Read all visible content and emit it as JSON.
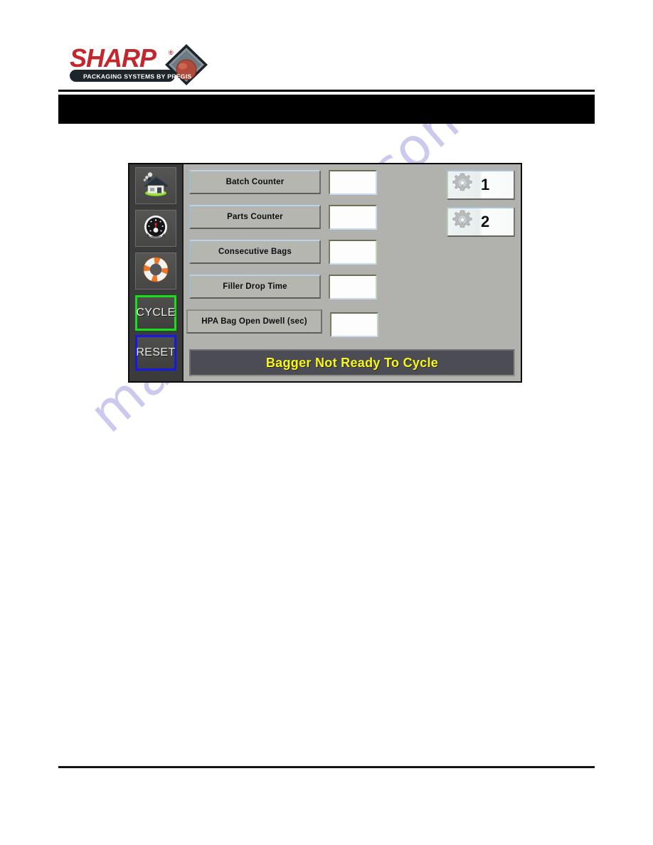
{
  "page": {
    "watermark": "manualshive.com",
    "background_color": "#ffffff"
  },
  "logo": {
    "brand": "SHARP",
    "registered_mark": "®",
    "tagline": "PACKAGING SYSTEMS BY PREGIS",
    "brand_color": "#c1272d",
    "tagline_bg": "#1d252c",
    "tagline_color": "#ffffff"
  },
  "header": {
    "black_bar_color": "#000000",
    "rule_color": "#000000"
  },
  "hmi": {
    "screen_bg": "#b1b1ad",
    "sidebar_bg": "#3b3b3b",
    "sidebar": {
      "items": [
        {
          "name": "home",
          "icon": "house-icon",
          "label": ""
        },
        {
          "name": "diagnostics",
          "icon": "gauge-icon",
          "label": ""
        },
        {
          "name": "help",
          "icon": "lifering-icon",
          "label": ""
        }
      ],
      "cycle_button": {
        "label": "CYCLE",
        "border_color": "#16e016"
      },
      "reset_button": {
        "label": "RESET",
        "border_color": "#1818e8"
      }
    },
    "parameters": [
      {
        "label": "Batch Counter",
        "value": "",
        "wide": false
      },
      {
        "label": "Parts Counter",
        "value": "",
        "wide": false
      },
      {
        "label": "Consecutive Bags",
        "value": "",
        "wide": false
      },
      {
        "label": "Filler Drop Time",
        "value": "",
        "wide": false
      },
      {
        "label": "HPA Bag Open Dwell (sec)",
        "value": "",
        "wide": true
      }
    ],
    "recipe_buttons": [
      {
        "icon": "gear-icon",
        "label": "1"
      },
      {
        "icon": "gear-icon",
        "label": "2"
      }
    ],
    "status": {
      "text": "Bagger Not Ready To Cycle",
      "text_color": "#f7f718",
      "bg_color": "#4c4c54"
    }
  }
}
